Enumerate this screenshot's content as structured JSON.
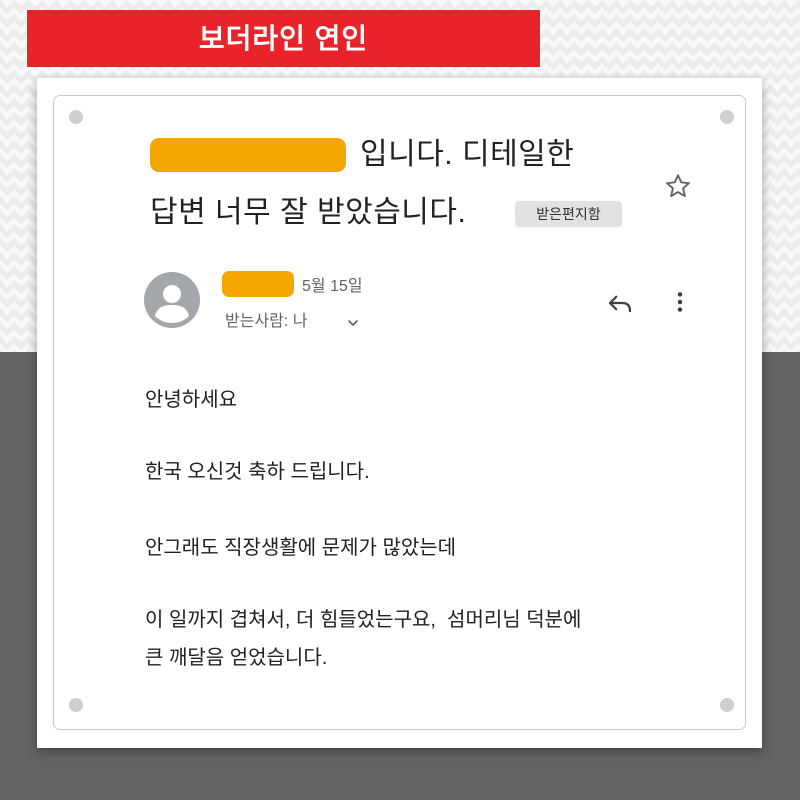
{
  "banner": {
    "title": "보더라인 연인"
  },
  "email": {
    "subject_line1": "입니다. 디테일한",
    "subject_line2": "답변 너무 잘 받았습니다.",
    "label": "받은편지함",
    "date": "5월 15일",
    "recipient": "받는사람: 나",
    "body": [
      "안녕하세요",
      "한국 오신것 축하 드립니다.",
      "안그래도 직장생활에 문제가 많았는데",
      "이 일까지 겹쳐서, 더 힘들었는구요,  섬머리님 덕분에",
      "큰 깨달음 얻었습니다."
    ]
  },
  "icons": {
    "star": "star-icon",
    "avatar": "person-icon",
    "reply": "reply-icon",
    "more": "more-vert-icon",
    "recipient_toggle": "chevron-down-icon"
  },
  "colors": {
    "banner": "#e8242a",
    "redaction": "#f4a700",
    "background_dark": "#646464",
    "label_bg": "#e2e2e2",
    "meta_text": "#5f6368"
  }
}
